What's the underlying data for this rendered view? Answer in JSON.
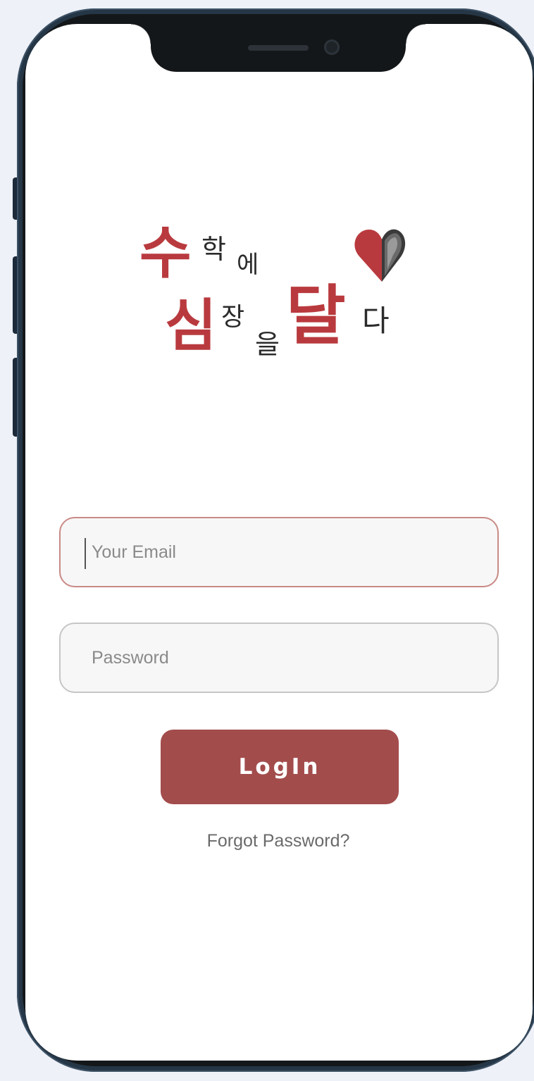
{
  "logo": {
    "line1": [
      "수",
      "학",
      "에"
    ],
    "line2": [
      "심",
      "장",
      "을",
      "달",
      "다"
    ],
    "accent_color": "#b93a3e",
    "text_color": "#2b2b2b",
    "icon": "heart-icon"
  },
  "login_form": {
    "email_placeholder": "Your Email",
    "password_placeholder": "Password",
    "login_label": "LogIn",
    "forgot_label": "Forgot Password?"
  },
  "colors": {
    "button": "#a34c4c",
    "email_border": "#c98a86",
    "phone_frame": "#253646"
  }
}
